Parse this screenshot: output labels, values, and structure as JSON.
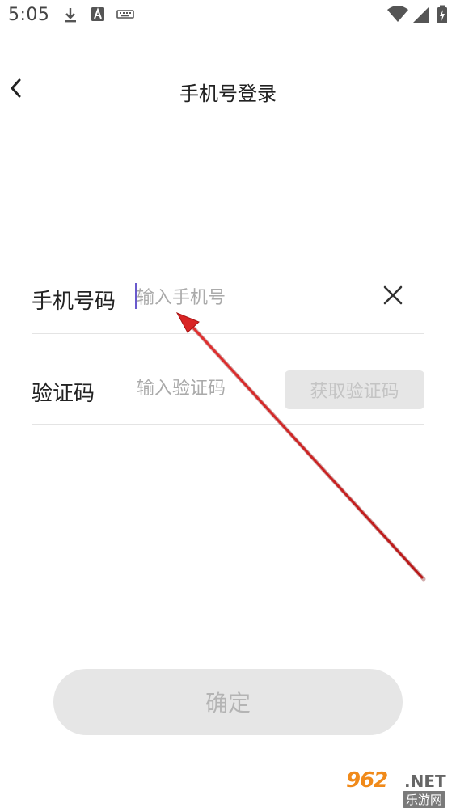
{
  "status_bar": {
    "time": "5:05",
    "left_icons": [
      "download-icon",
      "text-a-icon",
      "keyboard-icon"
    ],
    "right_icons": [
      "wifi-icon",
      "cell-signal-icon",
      "battery-charging-icon"
    ]
  },
  "header": {
    "title": "手机号登录",
    "back_icon": "chevron-left-icon"
  },
  "form": {
    "phone": {
      "label": "手机号码",
      "placeholder": "输入手机号",
      "value": "",
      "clear_icon": "close-icon"
    },
    "code": {
      "label": "验证码",
      "placeholder": "输入验证码",
      "value": "",
      "get_code_label": "获取验证码"
    }
  },
  "confirm": {
    "label": "确定"
  },
  "watermark": {
    "logo": "962",
    "net": ".NET",
    "sub": "乐游网"
  },
  "colors": {
    "arrow": "#d92424",
    "caret": "#6a5acd",
    "disabled_bg": "#e6e6e6",
    "disabled_text": "#b4b4b4",
    "watermark_orange": "#f08a1a"
  }
}
